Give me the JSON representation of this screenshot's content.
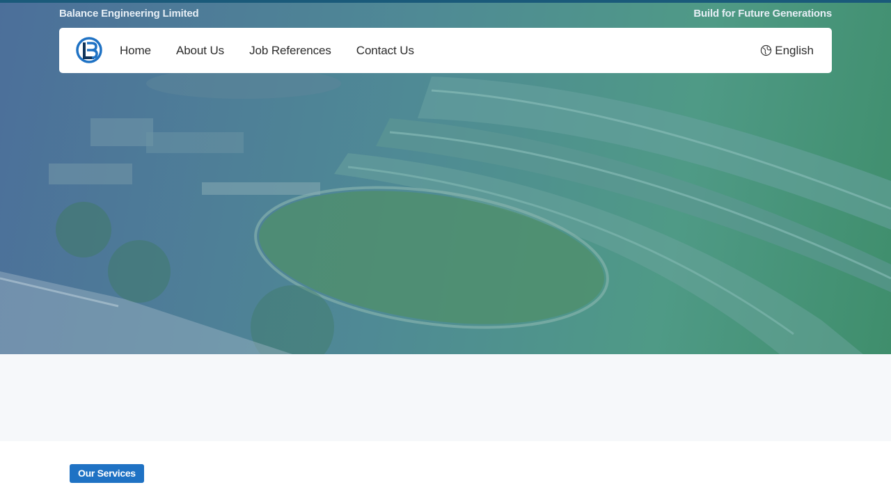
{
  "header": {
    "company_name": "Balance Engineering Limited",
    "slogan": "Build for Future Generations"
  },
  "navbar": {
    "logo_icon": "balance-engineering-logo-icon",
    "links": [
      {
        "label": "Home"
      },
      {
        "label": "About Us"
      },
      {
        "label": "Job References"
      },
      {
        "label": "Contact Us"
      }
    ],
    "language": {
      "icon": "globe-icon",
      "label": "English"
    }
  },
  "hero": {
    "image": "aerial-photo-of-plaza-and-curved-building"
  },
  "services": {
    "badge_label": "Our Services"
  },
  "colors": {
    "accent": "#1f72c4",
    "top_bar": "#1a5a7a",
    "hero_overlay_left": "#4c6f9a",
    "hero_overlay_right": "#3f8e6c",
    "band": "#f6f8fa"
  }
}
